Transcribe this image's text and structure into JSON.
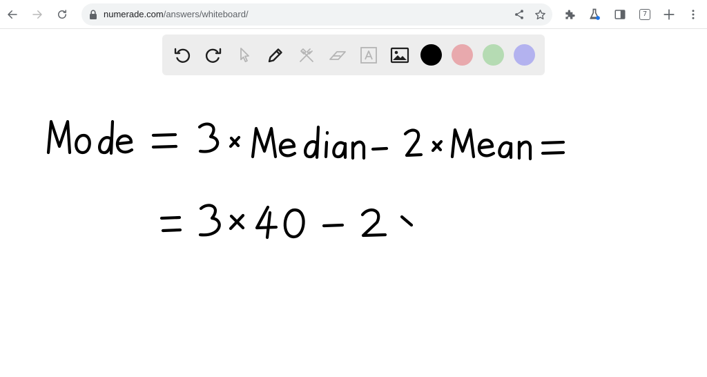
{
  "browser": {
    "url_host": "numerade.com",
    "url_path": "/answers/whiteboard/",
    "tab_count": "7",
    "icons": [
      "back-arrow-icon",
      "forward-arrow-icon",
      "reload-icon",
      "lock-icon",
      "share-icon",
      "star-icon",
      "extensions-puzzle-icon",
      "labs-flask-icon",
      "side-panel-icon",
      "tab-count-icon",
      "new-tab-plus-icon",
      "kebab-menu-icon"
    ]
  },
  "toolbar": {
    "tools": [
      "undo-icon",
      "redo-icon",
      "select-pointer-icon",
      "pen-icon",
      "tools-hammer-icon",
      "eraser-icon",
      "text-box-icon",
      "image-icon"
    ],
    "colors": {
      "black": "#000000",
      "pink": "#e8a9ad",
      "green": "#b5dbb3",
      "purple": "#b3b2ef",
      "toolbar_bg": "#ededed",
      "disabled_icon": "#b5b5b5"
    }
  },
  "whiteboard": {
    "line1": "Mode = 3×Median − 2×Mean =",
    "line2": "= 3×40 − 2×"
  }
}
